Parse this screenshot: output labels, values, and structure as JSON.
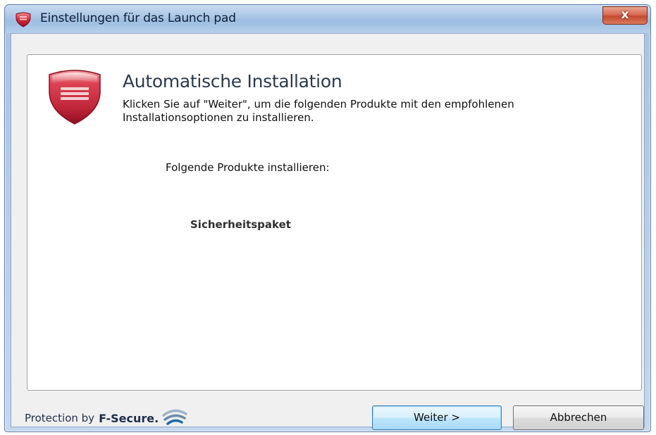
{
  "window": {
    "title": "Einstellungen für das Launch pad",
    "close_label": "x"
  },
  "main": {
    "heading": "Automatische Installation",
    "description": "Klicken Sie auf \"Weiter\", um die folgenden Produkte mit den empfohlenen Installationsoptionen zu installieren.",
    "products_label": "Folgende Produkte installieren:",
    "products": [
      "Sicherheitspaket"
    ]
  },
  "footer": {
    "brand_prefix": "Protection by",
    "brand_name": "F-Secure.",
    "next_button": "Weiter >",
    "cancel_button": "Abbrechen"
  },
  "icons": {
    "title": "f-secure-shield-icon",
    "product": "f-secure-shield-icon",
    "brand": "f-secure-wave-logo"
  },
  "colors": {
    "shield_red": "#c0263a",
    "titlebar_blue": "#a8c5e6",
    "close_red": "#c44a30",
    "default_button_border": "#3c7fb1"
  }
}
